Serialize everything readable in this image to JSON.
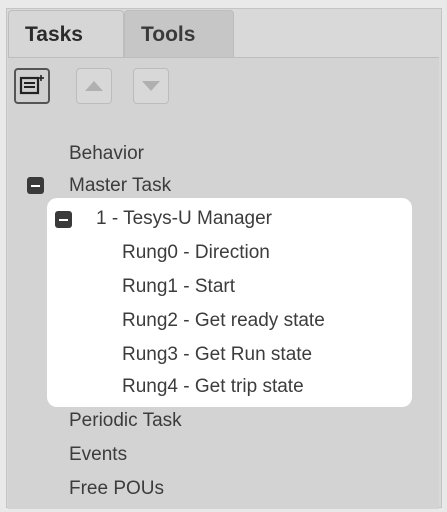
{
  "tabs": {
    "active": "Tasks",
    "inactive": "Tools"
  },
  "toolbar": {
    "add_icon": "add-list-icon",
    "up_icon": "move-up-icon",
    "down_icon": "move-down-icon"
  },
  "tree": {
    "behavior": "Behavior",
    "master_task": "Master Task",
    "manager": "1 - Tesys-U Manager",
    "rungs": [
      "Rung0 - Direction",
      "Rung1 - Start",
      "Rung2 - Get ready state",
      "Rung3 - Get Run state",
      "Rung4 - Get trip state"
    ],
    "periodic_task": "Periodic Task",
    "events": "Events",
    "free_pous": "Free POUs"
  }
}
